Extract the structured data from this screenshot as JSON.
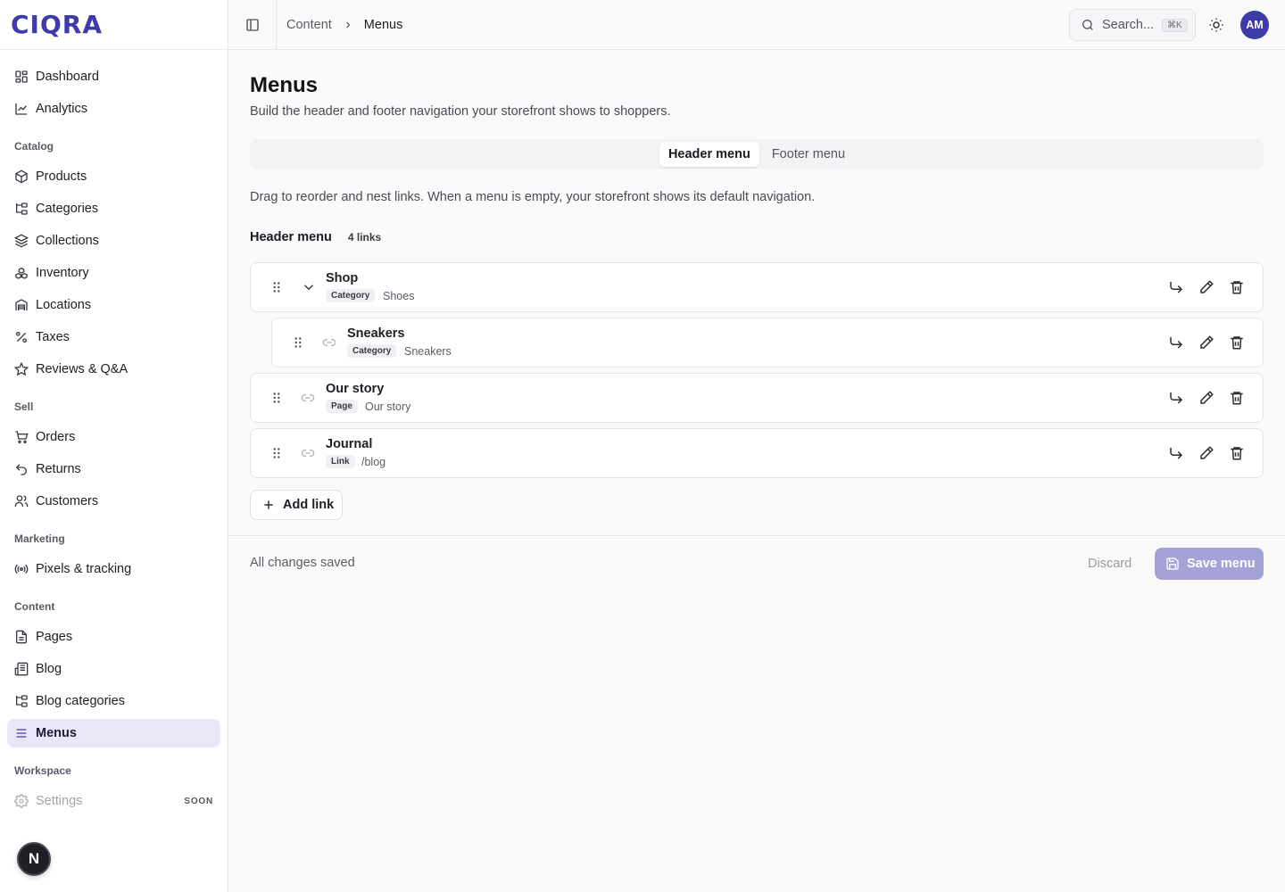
{
  "brand": {
    "logo_text": "CIQRA",
    "accent": "#3e3aa8"
  },
  "sidebar": {
    "items_top": [
      {
        "label": "Dashboard",
        "icon": "dashboard-icon"
      },
      {
        "label": "Analytics",
        "icon": "chart-line-icon"
      }
    ],
    "sections": {
      "catalog": {
        "label": "Catalog",
        "items": [
          {
            "label": "Products",
            "icon": "package-icon"
          },
          {
            "label": "Categories",
            "icon": "folder-tree-icon"
          },
          {
            "label": "Collections",
            "icon": "layers-icon"
          },
          {
            "label": "Inventory",
            "icon": "boxes-icon"
          },
          {
            "label": "Locations",
            "icon": "warehouse-icon"
          },
          {
            "label": "Taxes",
            "icon": "percent-icon"
          },
          {
            "label": "Reviews & Q&A",
            "icon": "star-icon"
          }
        ]
      },
      "sell": {
        "label": "Sell",
        "items": [
          {
            "label": "Orders",
            "icon": "cart-icon"
          },
          {
            "label": "Returns",
            "icon": "undo-icon"
          },
          {
            "label": "Customers",
            "icon": "users-icon"
          }
        ]
      },
      "marketing": {
        "label": "Marketing",
        "items": [
          {
            "label": "Pixels & tracking",
            "icon": "radio-icon"
          }
        ]
      },
      "content": {
        "label": "Content",
        "items": [
          {
            "label": "Pages",
            "icon": "file-icon"
          },
          {
            "label": "Blog",
            "icon": "newspaper-icon"
          },
          {
            "label": "Blog categories",
            "icon": "folder-tree-icon"
          },
          {
            "label": "Menus",
            "icon": "menu-icon",
            "active": true
          }
        ]
      },
      "workspace": {
        "label": "Workspace",
        "items": [
          {
            "label": "Settings",
            "icon": "gear-icon",
            "badge": "SOON",
            "disabled": true
          }
        ]
      }
    },
    "fab_letter": "N"
  },
  "topbar": {
    "breadcrumb": [
      "Content",
      "Menus"
    ],
    "search_placeholder": "Search...",
    "search_shortcut": "⌘K",
    "avatar_initials": "AM"
  },
  "page": {
    "title": "Menus",
    "subtitle": "Build the header and footer navigation your storefront shows to shoppers.",
    "tabs": [
      {
        "label": "Header menu",
        "active": true
      },
      {
        "label": "Footer menu",
        "active": false
      }
    ],
    "hint": "Drag to reorder and nest links. When a menu is empty, your storefront shows its default navigation.",
    "list_title": "Header menu",
    "list_count": "4 links",
    "links": [
      {
        "name": "Shop",
        "type": "Category",
        "target": "Shoes",
        "depth": 0,
        "has_children": true
      },
      {
        "name": "Sneakers",
        "type": "Category",
        "target": "Sneakers",
        "depth": 1,
        "has_children": false
      },
      {
        "name": "Our story",
        "type": "Page",
        "target": "Our story",
        "depth": 0,
        "has_children": false
      },
      {
        "name": "Journal",
        "type": "Link",
        "target": "/blog",
        "depth": 0,
        "has_children": false
      }
    ],
    "add_link_label": "Add link"
  },
  "footer": {
    "status": "All changes saved",
    "discard_label": "Discard",
    "save_label": "Save menu",
    "save_color": "#a5a2d8"
  }
}
